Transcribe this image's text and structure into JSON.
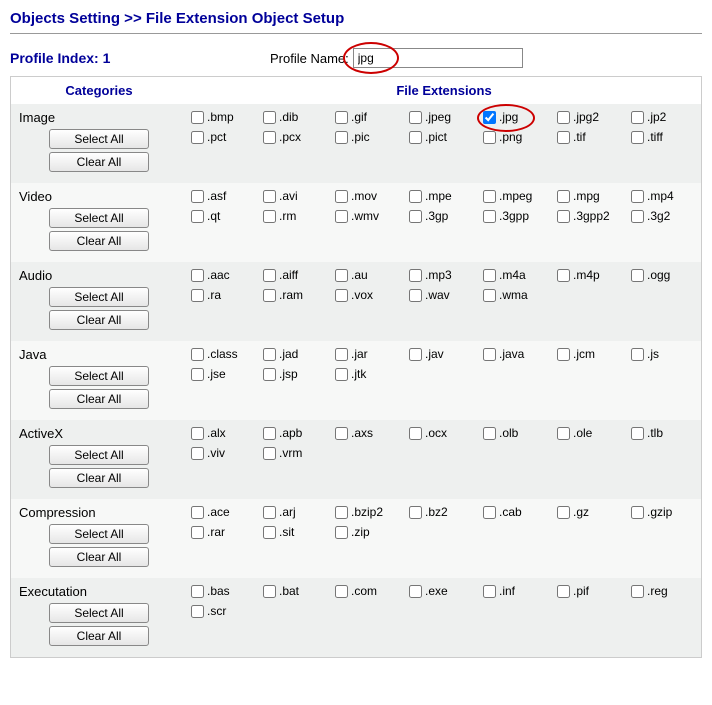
{
  "title": "Objects Setting >> File Extension Object Setup",
  "profile": {
    "index_label": "Profile Index: 1",
    "name_label": "Profile Name:",
    "name_value": "jpg"
  },
  "headers": {
    "categories": "Categories",
    "extensions": "File Extensions"
  },
  "buttons": {
    "select_all": "Select All",
    "clear_all": "Clear All"
  },
  "groups": [
    {
      "name": "Image",
      "exts": [
        {
          "l": ".bmp"
        },
        {
          "l": ".dib"
        },
        {
          "l": ".gif"
        },
        {
          "l": ".jpeg"
        },
        {
          "l": ".jpg",
          "checked": true,
          "highlight": true
        },
        {
          "l": ".jpg2"
        },
        {
          "l": ".jp2"
        },
        {
          "l": ".pct"
        },
        {
          "l": ".pcx"
        },
        {
          "l": ".pic"
        },
        {
          "l": ".pict"
        },
        {
          "l": ".png"
        },
        {
          "l": ".tif"
        },
        {
          "l": ".tiff"
        }
      ]
    },
    {
      "name": "Video",
      "exts": [
        {
          "l": ".asf"
        },
        {
          "l": ".avi"
        },
        {
          "l": ".mov"
        },
        {
          "l": ".mpe"
        },
        {
          "l": ".mpeg"
        },
        {
          "l": ".mpg"
        },
        {
          "l": ".mp4"
        },
        {
          "l": ".qt"
        },
        {
          "l": ".rm"
        },
        {
          "l": ".wmv"
        },
        {
          "l": ".3gp"
        },
        {
          "l": ".3gpp"
        },
        {
          "l": ".3gpp2"
        },
        {
          "l": ".3g2"
        }
      ]
    },
    {
      "name": "Audio",
      "exts": [
        {
          "l": ".aac"
        },
        {
          "l": ".aiff"
        },
        {
          "l": ".au"
        },
        {
          "l": ".mp3"
        },
        {
          "l": ".m4a"
        },
        {
          "l": ".m4p"
        },
        {
          "l": ".ogg"
        },
        {
          "l": ".ra"
        },
        {
          "l": ".ram"
        },
        {
          "l": ".vox"
        },
        {
          "l": ".wav"
        },
        {
          "l": ".wma"
        }
      ]
    },
    {
      "name": "Java",
      "exts": [
        {
          "l": ".class"
        },
        {
          "l": ".jad"
        },
        {
          "l": ".jar"
        },
        {
          "l": ".jav"
        },
        {
          "l": ".java"
        },
        {
          "l": ".jcm"
        },
        {
          "l": ".js"
        },
        {
          "l": ".jse"
        },
        {
          "l": ".jsp"
        },
        {
          "l": ".jtk"
        }
      ]
    },
    {
      "name": "ActiveX",
      "exts": [
        {
          "l": ".alx"
        },
        {
          "l": ".apb"
        },
        {
          "l": ".axs"
        },
        {
          "l": ".ocx"
        },
        {
          "l": ".olb"
        },
        {
          "l": ".ole"
        },
        {
          "l": ".tlb"
        },
        {
          "l": ".viv"
        },
        {
          "l": ".vrm"
        }
      ]
    },
    {
      "name": "Compression",
      "exts": [
        {
          "l": ".ace"
        },
        {
          "l": ".arj"
        },
        {
          "l": ".bzip2"
        },
        {
          "l": ".bz2"
        },
        {
          "l": ".cab"
        },
        {
          "l": ".gz"
        },
        {
          "l": ".gzip"
        },
        {
          "l": ".rar"
        },
        {
          "l": ".sit"
        },
        {
          "l": ".zip"
        }
      ]
    },
    {
      "name": "Executation",
      "exts": [
        {
          "l": ".bas"
        },
        {
          "l": ".bat"
        },
        {
          "l": ".com"
        },
        {
          "l": ".exe"
        },
        {
          "l": ".inf"
        },
        {
          "l": ".pif"
        },
        {
          "l": ".reg"
        },
        {
          "l": ".scr"
        }
      ]
    }
  ]
}
